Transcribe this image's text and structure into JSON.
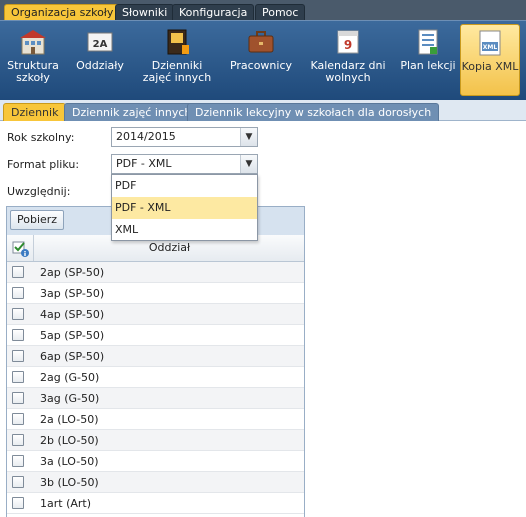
{
  "top_tabs": [
    {
      "label": "Organizacja szkoły",
      "active": true
    },
    {
      "label": "Słowniki",
      "active": false
    },
    {
      "label": "Konfiguracja",
      "active": false
    },
    {
      "label": "Pomoc",
      "active": false
    }
  ],
  "ribbon": [
    {
      "label": "Struktura szkoły",
      "icon": "school-structure-icon"
    },
    {
      "label": "Oddziały",
      "icon": "class-2a-icon"
    },
    {
      "label": "Dzienniki zajęć innych",
      "icon": "journal-icon"
    },
    {
      "label": "Pracownicy",
      "icon": "briefcase-icon"
    },
    {
      "label": "Kalendarz dni wolnych",
      "icon": "calendar-icon"
    },
    {
      "label": "Plan lekcji",
      "icon": "lesson-plan-icon"
    },
    {
      "label": "Kopia XML",
      "icon": "xml-copy-icon",
      "active": true
    }
  ],
  "sub_tabs": [
    {
      "label": "Dziennik",
      "active": true
    },
    {
      "label": "Dziennik zajęć innych",
      "active": false
    },
    {
      "label": "Dziennik lekcyjny w szkołach dla dorosłych",
      "active": false
    }
  ],
  "form": {
    "year_label": "Rok szkolny:",
    "year_value": "2014/2015",
    "format_label": "Format pliku:",
    "format_value": "PDF - XML",
    "include_label": "Uwzględnij:",
    "format_options": [
      "PDF",
      "PDF - XML",
      "XML"
    ],
    "selected_option": "PDF - XML"
  },
  "grid": {
    "fetch_label": "Pobierz",
    "column_header": "Oddział",
    "rows": [
      "2ap (SP-50)",
      "3ap (SP-50)",
      "4ap (SP-50)",
      "5ap (SP-50)",
      "6ap (SP-50)",
      "2ag (G-50)",
      "3ag (G-50)",
      "2a (LO-50)",
      "2b (LO-50)",
      "3a (LO-50)",
      "3b (LO-50)",
      "1art (Art)"
    ]
  },
  "colors": {
    "accent": "#f8c63a",
    "ribbon": "#2b5688",
    "selected_option": "#fde9a2"
  }
}
